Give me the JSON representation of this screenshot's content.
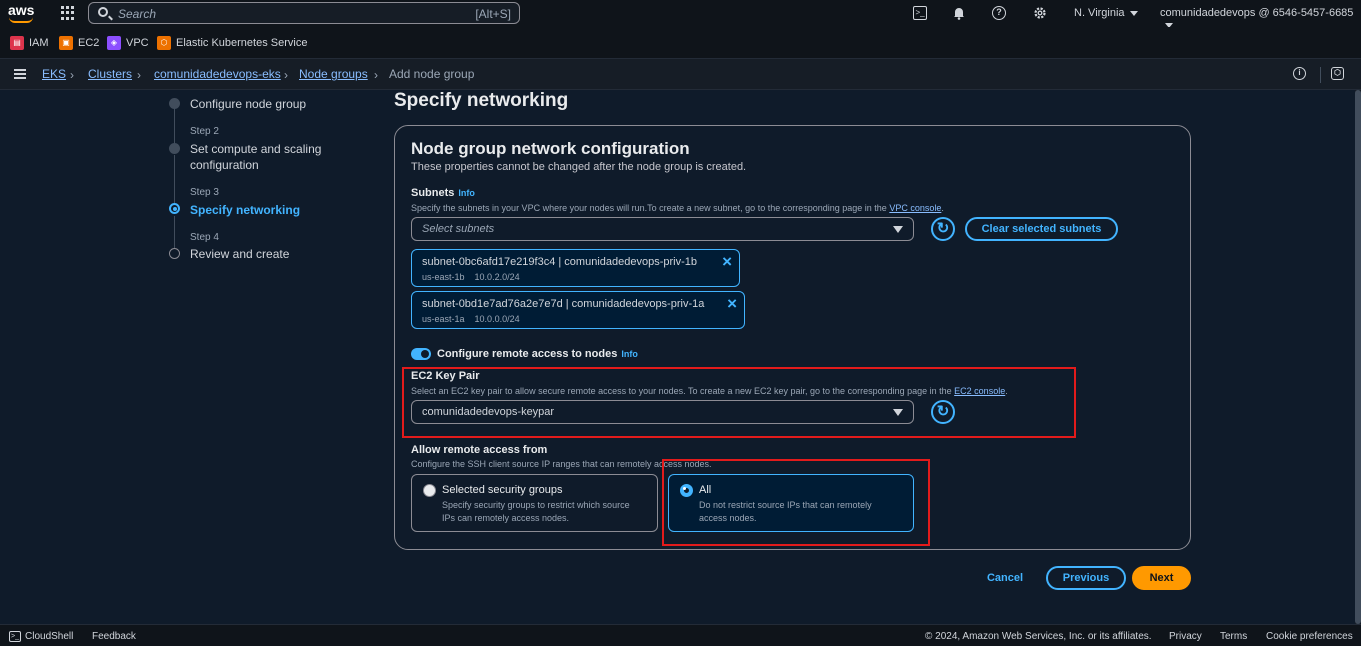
{
  "topbar": {
    "logo": "aws",
    "search_placeholder": "Search",
    "search_shortcut": "[Alt+S]",
    "region": "N. Virginia",
    "account": "comunidadedevops @ 6546-5457-6685"
  },
  "favorites": [
    {
      "label": "IAM",
      "color": "#dd344c"
    },
    {
      "label": "EC2",
      "color": "#ed7100"
    },
    {
      "label": "VPC",
      "color": "#8c4fff"
    },
    {
      "label": "Elastic Kubernetes Service",
      "color": "#ed7100"
    }
  ],
  "breadcrumbs": [
    "EKS",
    "Clusters",
    "comunidadedevops-eks",
    "Node groups",
    "Add node group"
  ],
  "steps": [
    {
      "num": "",
      "title": "Configure node group"
    },
    {
      "num": "Step 2",
      "title": "Set compute and scaling configuration"
    },
    {
      "num": "Step 3",
      "title": "Specify networking"
    },
    {
      "num": "Step 4",
      "title": "Review and create"
    }
  ],
  "page_title": "Specify networking",
  "card": {
    "title": "Node group network configuration",
    "desc": "These properties cannot be changed after the node group is created.",
    "subnets_label": "Subnets",
    "info": "Info",
    "subnets_desc": "Specify the subnets in your VPC where your nodes will run.To create a new subnet, go to the corresponding page in the",
    "vpc_console": "VPC console",
    "period": ".",
    "subnet_placeholder": "Select subnets",
    "clear_button": "Clear selected subnets",
    "subnets": [
      {
        "name": "subnet-0bc6afd17e219f3c4 | comunidadedevops-priv-1b",
        "az": "us-east-1b",
        "cidr": "10.0.2.0/24"
      },
      {
        "name": "subnet-0bd1e7ad76a2e7e7d | comunidadedevops-priv-1a",
        "az": "us-east-1a",
        "cidr": "10.0.0.0/24"
      }
    ],
    "remote_access_label": "Configure remote access to nodes",
    "keypair_label": "EC2 Key Pair",
    "keypair_desc": "Select an EC2 key pair to allow secure remote access to your nodes. To create a new EC2 key pair, go to the corresponding page in the",
    "ec2_console": "EC2 console",
    "keypair_value": "comunidadedevops-keypar",
    "allow_label": "Allow remote access from",
    "allow_desc": "Configure the SSH client source IP ranges that can remotely access nodes.",
    "tiles": [
      {
        "title": "Selected security groups",
        "desc": "Specify security groups to restrict which source IPs can remotely access nodes."
      },
      {
        "title": "All",
        "desc": "Do not restrict source IPs that can remotely access nodes."
      }
    ]
  },
  "actions": {
    "cancel": "Cancel",
    "previous": "Previous",
    "next": "Next"
  },
  "statusbar": {
    "cloudshell": "CloudShell",
    "feedback": "Feedback",
    "copyright": "© 2024, Amazon Web Services, Inc. or its affiliates.",
    "privacy": "Privacy",
    "terms": "Terms",
    "cookies": "Cookie preferences"
  }
}
